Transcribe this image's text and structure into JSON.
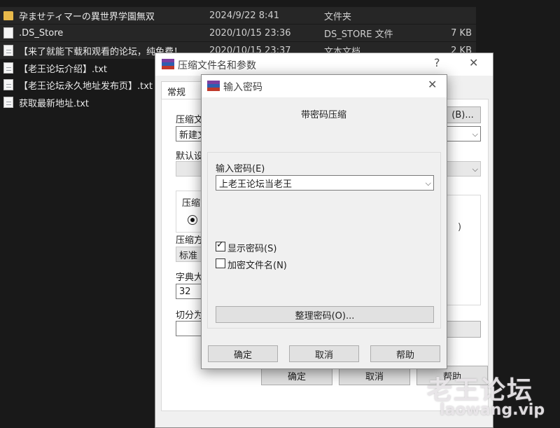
{
  "explorer": {
    "files": [
      {
        "name": "孕ませティマーの異世界学園無双",
        "date": "2024/9/22 8:41",
        "type": "文件夹",
        "size": "",
        "icon": "folder-icon"
      },
      {
        "name": ".DS_Store",
        "date": "2020/10/15 23:36",
        "type": "DS_STORE 文件",
        "size": "7 KB",
        "icon": "file-icon"
      },
      {
        "name": "【来了就能下载和观看的论坛，纯免费！",
        "date": "2020/10/15 23:37",
        "type": "文本文档",
        "size": "2 KB",
        "icon": "text-file-icon"
      },
      {
        "name": "【老王论坛介绍】.txt",
        "date": "",
        "type": "",
        "size": "",
        "icon": "text-file-icon"
      },
      {
        "name": "【老王论坛永久地址发布页】.txt",
        "date": "",
        "type": "",
        "size": "",
        "icon": "text-file-icon"
      },
      {
        "name": "获取最新地址.txt",
        "date": "",
        "type": "",
        "size": "",
        "icon": "text-file-icon"
      }
    ]
  },
  "archive_dialog": {
    "title": "压缩文件名和参数",
    "help_glyph": "?",
    "close_glyph": "✕",
    "tab_general": "常规",
    "browse_label": "(B)...",
    "archive_name_label": "压缩文",
    "archive_name_value": "新建文",
    "default_label": "默认设",
    "format_group_label": "压缩",
    "method_label": "压缩方",
    "method_value": "标准",
    "dict_label": "字典大",
    "dict_value": "32",
    "split_label": "切分为",
    "tail_glyph": ")",
    "ok_label": "确定",
    "cancel_label": "取消",
    "help_label": "帮助"
  },
  "password_dialog": {
    "title": "输入密码",
    "close_glyph": "✕",
    "heading": "带密码压缩",
    "password_label": "输入密码(E)",
    "password_value": "上老王论坛当老王",
    "show_password_label": "显示密码(S)",
    "show_password_checked": true,
    "encrypt_names_label": "加密文件名(N)",
    "encrypt_names_checked": false,
    "organize_label": "整理密码(O)...",
    "ok_label": "确定",
    "cancel_label": "取消",
    "help_label": "帮助"
  },
  "watermark": {
    "cn": "老王论坛",
    "en": "laowang.vip"
  },
  "colors": {
    "explorer_bg": "#191919",
    "dialog_bg": "#f0f0f0",
    "folder": "#e8b94a",
    "winrar_red": "#c0392b",
    "winrar_blue": "#2e5fb0",
    "winrar_purple": "#7b3fa0"
  }
}
